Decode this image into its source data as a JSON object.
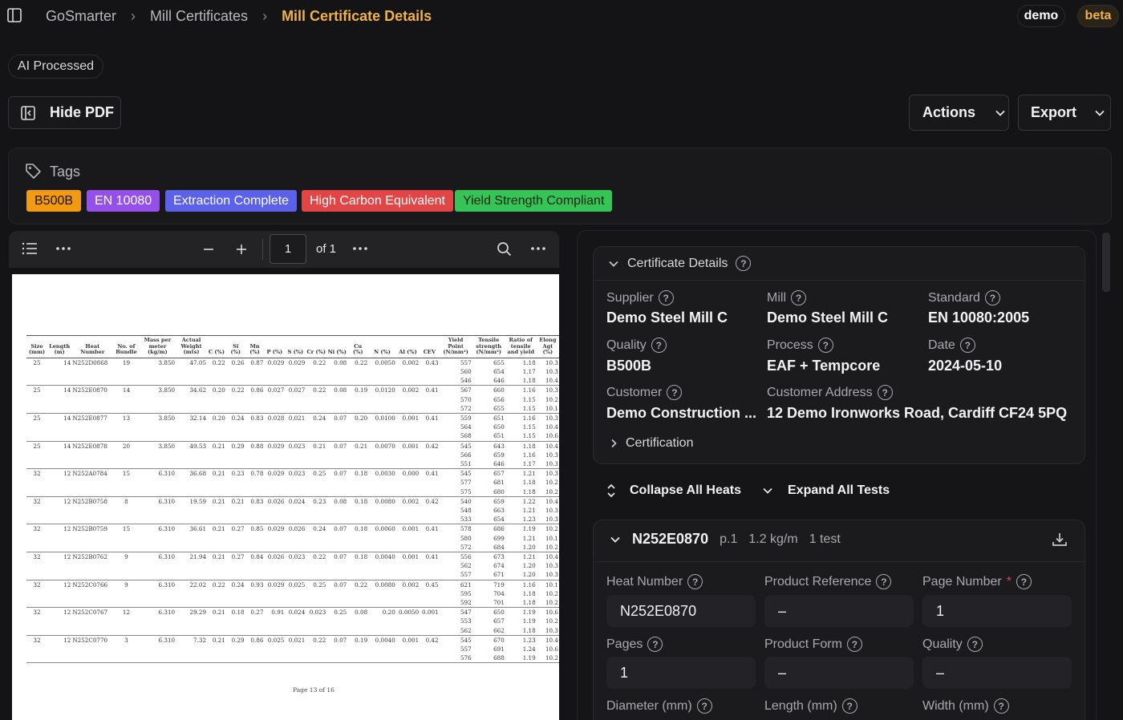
{
  "breadcrumb": {
    "root": "GoSmarter",
    "parent": "Mill Certificates",
    "current": "Mill Certificate Details"
  },
  "badges": {
    "user": "demo",
    "stage": "beta"
  },
  "status": "AI Processed",
  "toolbar": {
    "hide_pdf": "Hide PDF",
    "actions": "Actions",
    "export": "Export"
  },
  "tags": {
    "title": "Tags",
    "items": [
      {
        "label": "B500B",
        "color": "#f29b12"
      },
      {
        "label": "EN 10080",
        "color": "#9450e8"
      },
      {
        "label": "Extraction Complete",
        "color": "#5b61e8"
      },
      {
        "label": "High Carbon Equivalent",
        "color": "#e24545"
      },
      {
        "label": "Yield Strength Compliant",
        "color": "#35c455"
      }
    ]
  },
  "pdf": {
    "page_value": "1",
    "page_of": "of 1",
    "footer": "Page 13 of 16",
    "headers": [
      "Size (mm)",
      "Length (m)",
      "Heat Number",
      "No. of Bundle",
      "Mass per meter (kg/m)",
      "Actual Weight (mts)",
      "C (%)",
      "Si (%)",
      "Mn (%)",
      "P (%)",
      "S (%)",
      "Cr (%)",
      "Ni (%)",
      "Cu (%)",
      "N (%)",
      "Al (%)",
      "CEV",
      "Yield Point (N/mm²)",
      "Tensile strength (N/mm²)",
      "Ratio of tensile and yield",
      "Elong Agt (%)"
    ],
    "rows": [
      {
        "size": "25",
        "len": "14",
        "heat": "N252D0868",
        "bundle": "19",
        "mass": "3.850",
        "wt": "47.05",
        "c": "0.22",
        "si": "0.26",
        "mn": "0.87",
        "p": "0.029",
        "s": "0.029",
        "cr": "0.22",
        "ni": "0.08",
        "cu": "0.22",
        "n": "0.0050",
        "al": "0.002",
        "cev": "0.43",
        "yp": [
          "557",
          "560",
          "546"
        ],
        "ts": [
          "655",
          "654",
          "646"
        ],
        "ratio": [
          "1.18",
          "1.17",
          "1.18"
        ],
        "agt": [
          "10.3",
          "10.3",
          "10.4"
        ]
      },
      {
        "size": "25",
        "len": "14",
        "heat": "N252E0870",
        "bundle": "14",
        "mass": "3.850",
        "wt": "34.62",
        "c": "0.20",
        "si": "0.22",
        "mn": "0.86",
        "p": "0.027",
        "s": "0.027",
        "cr": "0.22",
        "ni": "0.08",
        "cu": "0.19",
        "n": "0.0120",
        "al": "0.002",
        "cev": "0.41",
        "yp": [
          "567",
          "570",
          "572"
        ],
        "ts": [
          "660",
          "656",
          "655"
        ],
        "ratio": [
          "1.16",
          "1.15",
          "1.15"
        ],
        "agt": [
          "10.3",
          "10.2",
          "10.1"
        ]
      },
      {
        "size": "25",
        "len": "14",
        "heat": "N252E0877",
        "bundle": "13",
        "mass": "3.850",
        "wt": "32.14",
        "c": "0.20",
        "si": "0.24",
        "mn": "0.83",
        "p": "0.028",
        "s": "0.021",
        "cr": "0.24",
        "ni": "0.07",
        "cu": "0.20",
        "n": "0.0100",
        "al": "0.001",
        "cev": "0.41",
        "yp": [
          "559",
          "564",
          "568"
        ],
        "ts": [
          "651",
          "650",
          "651"
        ],
        "ratio": [
          "1.16",
          "1.15",
          "1.15"
        ],
        "agt": [
          "10.3",
          "10.4",
          "10.6"
        ]
      },
      {
        "size": "25",
        "len": "14",
        "heat": "N252E0878",
        "bundle": "20",
        "mass": "3.850",
        "wt": "49.53",
        "c": "0.21",
        "si": "0.29",
        "mn": "0.88",
        "p": "0.029",
        "s": "0.023",
        "cr": "0.21",
        "ni": "0.07",
        "cu": "0.21",
        "n": "0.0070",
        "al": "0.001",
        "cev": "0.42",
        "yp": [
          "545",
          "566",
          "551"
        ],
        "ts": [
          "643",
          "659",
          "646"
        ],
        "ratio": [
          "1.18",
          "1.16",
          "1.17"
        ],
        "agt": [
          "10.4",
          "10.3",
          "10.3"
        ]
      },
      {
        "size": "32",
        "len": "12",
        "heat": "N252A0784",
        "bundle": "15",
        "mass": "6.310",
        "wt": "36.68",
        "c": "0.21",
        "si": "0.23",
        "mn": "0.78",
        "p": "0.029",
        "s": "0.023",
        "cr": "0.25",
        "ni": "0.07",
        "cu": "0.18",
        "n": "0.0030",
        "al": "0.000",
        "cev": "0.41",
        "yp": [
          "545",
          "577",
          "575"
        ],
        "ts": [
          "657",
          "681",
          "680"
        ],
        "ratio": [
          "1.21",
          "1.18",
          "1.18"
        ],
        "agt": [
          "10.3",
          "10.2",
          "10.2"
        ]
      },
      {
        "size": "32",
        "len": "12",
        "heat": "N252B0758",
        "bundle": "8",
        "mass": "6.310",
        "wt": "19.59",
        "c": "0.21",
        "si": "0.21",
        "mn": "0.83",
        "p": "0.026",
        "s": "0.024",
        "cr": "0.23",
        "ni": "0.08",
        "cu": "0.18",
        "n": "0.0080",
        "al": "0.002",
        "cev": "0.42",
        "yp": [
          "540",
          "548",
          "533"
        ],
        "ts": [
          "659",
          "663",
          "654"
        ],
        "ratio": [
          "1.22",
          "1.21",
          "1.23"
        ],
        "agt": [
          "10.4",
          "10.3",
          "10.3"
        ]
      },
      {
        "size": "32",
        "len": "12",
        "heat": "N252B0759",
        "bundle": "15",
        "mass": "6.310",
        "wt": "36.61",
        "c": "0.21",
        "si": "0.27",
        "mn": "0.85",
        "p": "0.029",
        "s": "0.026",
        "cr": "0.24",
        "ni": "0.07",
        "cu": "0.18",
        "n": "0.0060",
        "al": "0.001",
        "cev": "0.41",
        "yp": [
          "578",
          "580",
          "572"
        ],
        "ts": [
          "686",
          "699",
          "684"
        ],
        "ratio": [
          "1.19",
          "1.21",
          "1.20"
        ],
        "agt": [
          "10.2",
          "10.1",
          "10.2"
        ]
      },
      {
        "size": "32",
        "len": "12",
        "heat": "N252B0762",
        "bundle": "9",
        "mass": "6.310",
        "wt": "21.94",
        "c": "0.21",
        "si": "0.27",
        "mn": "0.84",
        "p": "0.026",
        "s": "0.023",
        "cr": "0.22",
        "ni": "0.07",
        "cu": "0.18",
        "n": "0.0040",
        "al": "0.001",
        "cev": "0.41",
        "yp": [
          "556",
          "562",
          "557"
        ],
        "ts": [
          "673",
          "674",
          "671"
        ],
        "ratio": [
          "1.21",
          "1.20",
          "1.20"
        ],
        "agt": [
          "10.4",
          "10.3",
          "10.3"
        ]
      },
      {
        "size": "32",
        "len": "12",
        "heat": "N252C0766",
        "bundle": "9",
        "mass": "6.310",
        "wt": "22.02",
        "c": "0.22",
        "si": "0.24",
        "mn": "0.93",
        "p": "0.029",
        "s": "0.025",
        "cr": "0.25",
        "ni": "0.07",
        "cu": "0.22",
        "n": "0.0080",
        "al": "0.002",
        "cev": "0.45",
        "yp": [
          "621",
          "595",
          "592"
        ],
        "ts": [
          "719",
          "704",
          "701"
        ],
        "ratio": [
          "1.16",
          "1.18",
          "1.18"
        ],
        "agt": [
          "10.1",
          "10.2",
          "10.2"
        ]
      },
      {
        "size": "32",
        "len": "12",
        "heat": "N252C0767",
        "bundle": "12",
        "mass": "6.310",
        "wt": "29.29",
        "c": "0.21",
        "si": "0.18",
        "mn": "0.27",
        "p": "0.91",
        "s": "0.024",
        "cr": "0.023",
        "ni": "0.25",
        "cu": "0.08",
        "n": "0.20",
        "al": "0.0050",
        "cev": "0.001",
        "extra": "0.40",
        "yp": [
          "547",
          "553",
          "562"
        ],
        "ts": [
          "650",
          "657",
          "662"
        ],
        "ratio": [
          "1.19",
          "1.19",
          "1.18"
        ],
        "agt": [
          "10.6",
          "10.2",
          "10.3"
        ]
      },
      {
        "size": "32",
        "len": "12",
        "heat": "N252C0770",
        "bundle": "3",
        "mass": "6.310",
        "wt": "7.32",
        "c": "0.21",
        "si": "0.29",
        "mn": "0.86",
        "p": "0.025",
        "s": "0.021",
        "cr": "0.22",
        "ni": "0.07",
        "cu": "0.19",
        "n": "0.0040",
        "al": "0.001",
        "cev": "0.42",
        "yp": [
          "545",
          "557",
          "576"
        ],
        "ts": [
          "670",
          "691",
          "688"
        ],
        "ratio": [
          "1.23",
          "1.24",
          "1.19"
        ],
        "agt": [
          "10.4",
          "10.6",
          "10.2"
        ]
      }
    ]
  },
  "details": {
    "section_title": "Certificate Details",
    "supplier": {
      "label": "Supplier",
      "value": "Demo Steel Mill C"
    },
    "mill": {
      "label": "Mill",
      "value": "Demo Steel Mill C"
    },
    "standard": {
      "label": "Standard",
      "value": "EN 10080:2005"
    },
    "quality": {
      "label": "Quality",
      "value": "B500B"
    },
    "process": {
      "label": "Process",
      "value": "EAF + Tempcore"
    },
    "date": {
      "label": "Date",
      "value": "2024-05-10"
    },
    "customer": {
      "label": "Customer",
      "value": "Demo Construction ..."
    },
    "customer_address": {
      "label": "Customer Address",
      "value": "12 Demo Ironworks Road, Cardiff CF24 5PQ"
    },
    "certification": "Certification"
  },
  "heats_controls": {
    "collapse": "Collapse All Heats",
    "expand": "Expand All Tests"
  },
  "heat": {
    "number": "N252E0870",
    "page": "p.1",
    "mass": "1.2 kg/m",
    "tests": "1 test",
    "fields": {
      "heat_number": {
        "label": "Heat Number",
        "value": "N252E0870"
      },
      "product_reference": {
        "label": "Product Reference",
        "value": "–"
      },
      "page_number": {
        "label": "Page Number",
        "required": "*",
        "value": "1"
      },
      "pages": {
        "label": "Pages",
        "value": "1"
      },
      "product_form": {
        "label": "Product Form",
        "value": "–"
      },
      "quality": {
        "label": "Quality",
        "value": "–"
      },
      "diameter": {
        "label": "Diameter (mm)"
      },
      "length": {
        "label": "Length (mm)"
      },
      "width": {
        "label": "Width (mm)"
      }
    }
  }
}
